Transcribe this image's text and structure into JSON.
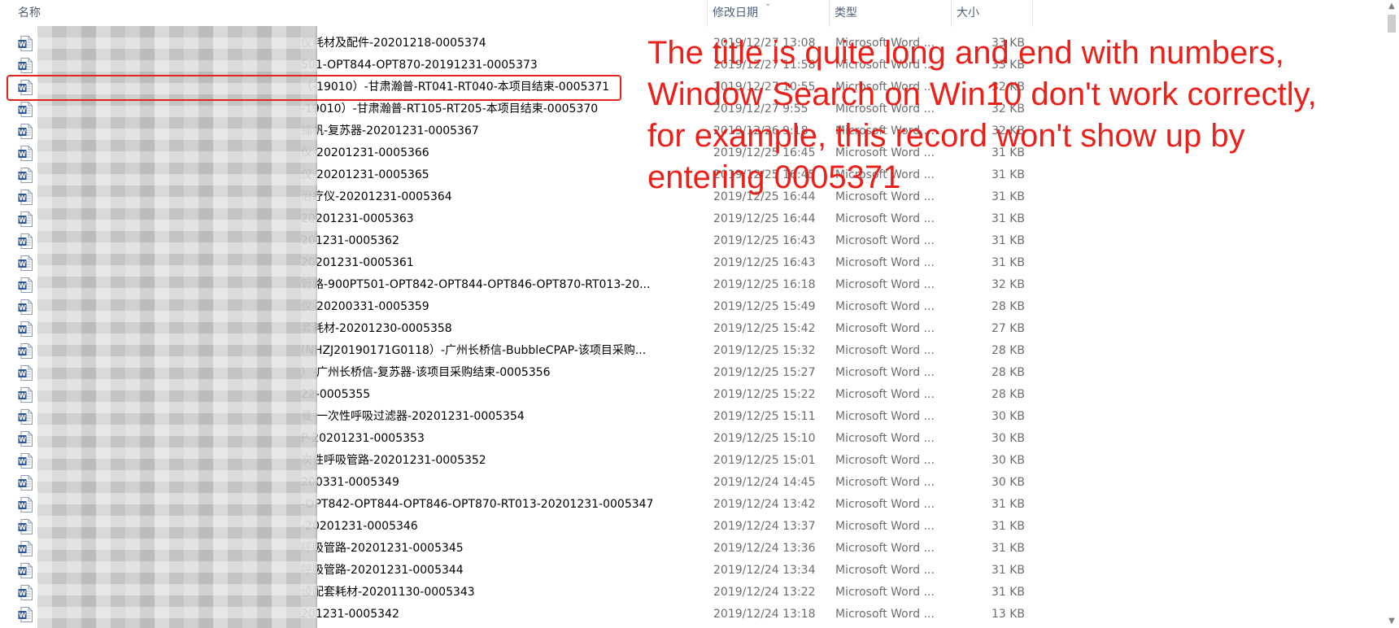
{
  "columns": {
    "name": "名称",
    "date": "修改日期",
    "type": "类型",
    "size": "大小"
  },
  "files": [
    {
      "name": "仪耗材及配件-20201218-0005374",
      "date": "2019/12/27 13:08",
      "type": "Microsoft Word ...",
      "size": "33 KB"
    },
    {
      "name": "501-OPT844-OPT870-20191231-0005373",
      "date": "2019/12/27 11:58",
      "type": "Microsoft Word ...",
      "size": "33 KB"
    },
    {
      "name": "（-19010）-甘肃瀚普-RT041-RT040-本项目结束-0005371",
      "date": "2019/12/27 10:55",
      "type": "Microsoft Word ...",
      "size": "32 KB"
    },
    {
      "name": "-19010）-甘肃瀚普-RT105-RT205-本项目结束-0005370",
      "date": "2019/12/27 9:55",
      "type": "Microsoft Word ...",
      "size": "32 KB"
    },
    {
      "name": "锦帆-复苏器-20201231-0005367",
      "date": "2019/12/26 9:18",
      "type": "Microsoft Word ...",
      "size": "32 KB"
    },
    {
      "name": "仪-20201231-0005366",
      "date": "2019/12/25 16:45",
      "type": "Microsoft Word ...",
      "size": "31 KB"
    },
    {
      "name": "仪-20201231-0005365",
      "date": "2019/12/25 16:45",
      "type": "Microsoft Word ...",
      "size": "31 KB"
    },
    {
      "name": "治疗仪-20201231-0005364",
      "date": "2019/12/25 16:44",
      "type": "Microsoft Word ...",
      "size": "31 KB"
    },
    {
      "name": "20201231-0005363",
      "date": "2019/12/25 16:44",
      "type": "Microsoft Word ...",
      "size": "31 KB"
    },
    {
      "name": "201231-0005362",
      "date": "2019/12/25 16:43",
      "type": "Microsoft Word ...",
      "size": "31 KB"
    },
    {
      "name": "20201231-0005361",
      "date": "2019/12/25 16:43",
      "type": "Microsoft Word ...",
      "size": "31 KB"
    },
    {
      "name": "管路-900PT501-OPT842-OPT844-OPT846-OPT870-RT013-20...",
      "date": "2019/12/25 16:18",
      "type": "Microsoft Word ...",
      "size": "32 KB"
    },
    {
      "name": "仪-20200331-0005359",
      "date": "2019/12/25 15:49",
      "type": "Microsoft Word ...",
      "size": "28 KB"
    },
    {
      "name": "套耗材-20201230-0005358",
      "date": "2019/12/25 15:42",
      "type": "Microsoft Word ...",
      "size": "27 KB"
    },
    {
      "name": "(NHZJ20190171G0118）-广州长桥信-BubbleCPAP-该项目采购...",
      "date": "2019/12/25 15:32",
      "type": "Microsoft Word ...",
      "size": "28 KB"
    },
    {
      "name": "）-广州长桥信-复苏器-该项目采购结束-0005356",
      "date": "2019/12/25 15:27",
      "type": "Microsoft Word ...",
      "size": "28 KB"
    },
    {
      "name": "22-0005355",
      "date": "2019/12/25 15:22",
      "type": "Microsoft Word ...",
      "size": "28 KB"
    },
    {
      "name": "曼-一次性呼吸过滤器-20201231-0005354",
      "date": "2019/12/25 15:11",
      "type": "Microsoft Word ...",
      "size": "30 KB"
    },
    {
      "name": "P-20201231-0005353",
      "date": "2019/12/25 15:10",
      "type": "Microsoft Word ...",
      "size": "30 KB"
    },
    {
      "name": "次性呼吸管路-20201231-0005352",
      "date": "2019/12/25 15:01",
      "type": "Microsoft Word ...",
      "size": "30 KB"
    },
    {
      "name": "200331-0005349",
      "date": "2019/12/24 14:45",
      "type": "Microsoft Word ...",
      "size": "30 KB"
    },
    {
      "name": "-OPT842-OPT844-OPT846-OPT870-RT013-20201231-0005347",
      "date": "2019/12/24 13:42",
      "type": "Microsoft Word ...",
      "size": "31 KB"
    },
    {
      "name": "-20201231-0005346",
      "date": "2019/12/24 13:37",
      "type": "Microsoft Word ...",
      "size": "31 KB"
    },
    {
      "name": "呼吸管路-20201231-0005345",
      "date": "2019/12/24 13:36",
      "type": "Microsoft Word ...",
      "size": "31 KB"
    },
    {
      "name": "呼吸管路-20201231-0005344",
      "date": "2019/12/24 13:34",
      "type": "Microsoft Word ...",
      "size": "31 KB"
    },
    {
      "name": "设配套耗材-20201130-0005343",
      "date": "2019/12/24 13:22",
      "type": "Microsoft Word ...",
      "size": "31 KB"
    },
    {
      "name": "201231-0005342",
      "date": "2019/12/24 13:18",
      "type": "Microsoft Word ...",
      "size": "13 KB"
    }
  ],
  "annotation": {
    "lines": [
      "The title is quite long and end with numbers,",
      "Window Search on Win10 don't work correctly,",
      "for example, this record won't show up by",
      "entering 0005371"
    ],
    "color": "#e8211b"
  },
  "icons": {
    "file": "word-document-icon",
    "sort": "sort-descending-icon"
  }
}
